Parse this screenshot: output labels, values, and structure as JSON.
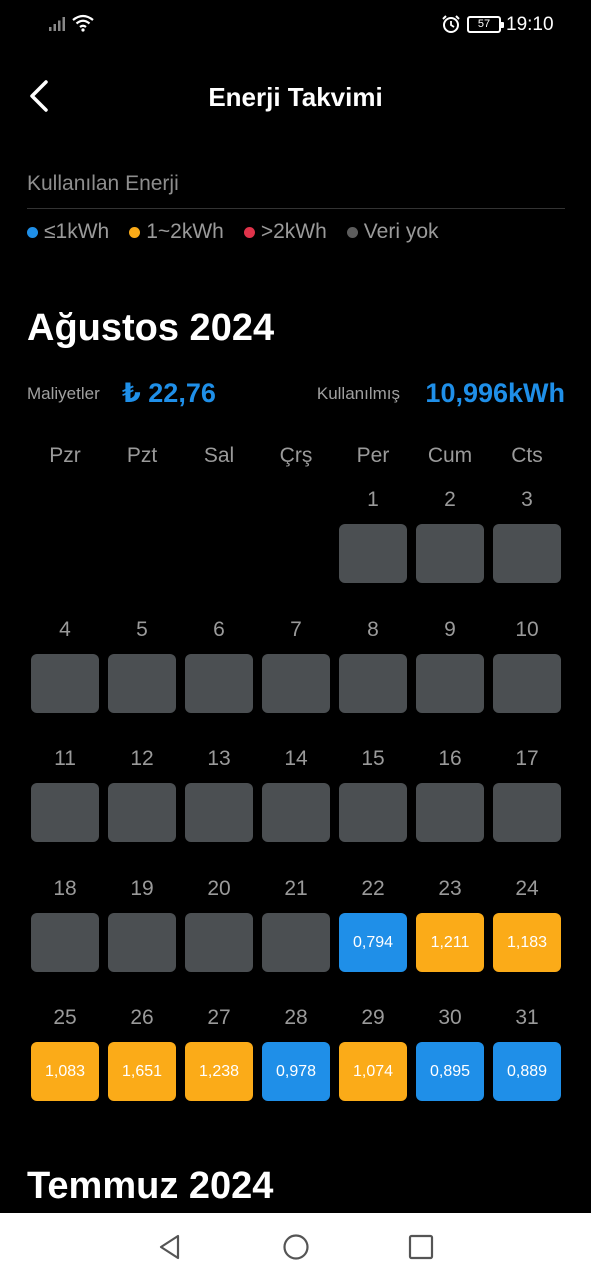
{
  "status": {
    "time": "19:10",
    "battery": "57"
  },
  "header": {
    "title": "Enerji Takvimi"
  },
  "section_label": "Kullanılan Enerji",
  "legend": [
    {
      "label": "≤1kWh",
      "color": "#1f8fe8"
    },
    {
      "label": "1~2kWh",
      "color": "#fbab18"
    },
    {
      "label": ">2kWh",
      "color": "#e0334a"
    },
    {
      "label": "Veri yok",
      "color": "#5d5d5d"
    }
  ],
  "month": {
    "title": "Ağustos 2024",
    "cost_label": "Maliyetler",
    "cost_value": "₺ 22,76",
    "usage_label": "Kullanılmış",
    "usage_value": "10,996kWh",
    "weekdays": [
      "Pzr",
      "Pzt",
      "Sal",
      "Çrş",
      "Per",
      "Cum",
      "Cts"
    ],
    "first_day_column": 4,
    "days": [
      {
        "day": "1",
        "value": "",
        "level": "none"
      },
      {
        "day": "2",
        "value": "",
        "level": "none"
      },
      {
        "day": "3",
        "value": "",
        "level": "none"
      },
      {
        "day": "4",
        "value": "",
        "level": "none"
      },
      {
        "day": "5",
        "value": "",
        "level": "none"
      },
      {
        "day": "6",
        "value": "",
        "level": "none"
      },
      {
        "day": "7",
        "value": "",
        "level": "none"
      },
      {
        "day": "8",
        "value": "",
        "level": "none"
      },
      {
        "day": "9",
        "value": "",
        "level": "none"
      },
      {
        "day": "10",
        "value": "",
        "level": "none"
      },
      {
        "day": "11",
        "value": "",
        "level": "none"
      },
      {
        "day": "12",
        "value": "",
        "level": "none"
      },
      {
        "day": "13",
        "value": "",
        "level": "none"
      },
      {
        "day": "14",
        "value": "",
        "level": "none"
      },
      {
        "day": "15",
        "value": "",
        "level": "none"
      },
      {
        "day": "16",
        "value": "",
        "level": "none"
      },
      {
        "day": "17",
        "value": "",
        "level": "none"
      },
      {
        "day": "18",
        "value": "",
        "level": "none"
      },
      {
        "day": "19",
        "value": "",
        "level": "none"
      },
      {
        "day": "20",
        "value": "",
        "level": "none"
      },
      {
        "day": "21",
        "value": "",
        "level": "none"
      },
      {
        "day": "22",
        "value": "0,794",
        "level": "blue"
      },
      {
        "day": "23",
        "value": "1,211",
        "level": "orange"
      },
      {
        "day": "24",
        "value": "1,183",
        "level": "orange"
      },
      {
        "day": "25",
        "value": "1,083",
        "level": "orange"
      },
      {
        "day": "26",
        "value": "1,651",
        "level": "orange"
      },
      {
        "day": "27",
        "value": "1,238",
        "level": "orange"
      },
      {
        "day": "28",
        "value": "0,978",
        "level": "blue"
      },
      {
        "day": "29",
        "value": "1,074",
        "level": "orange"
      },
      {
        "day": "30",
        "value": "0,895",
        "level": "blue"
      },
      {
        "day": "31",
        "value": "0,889",
        "level": "blue"
      }
    ]
  },
  "next_month": {
    "title": "Temmuz 2024"
  },
  "navbar": {
    "icons": [
      "back-triangle-icon",
      "home-circle-icon",
      "recents-square-icon"
    ]
  }
}
